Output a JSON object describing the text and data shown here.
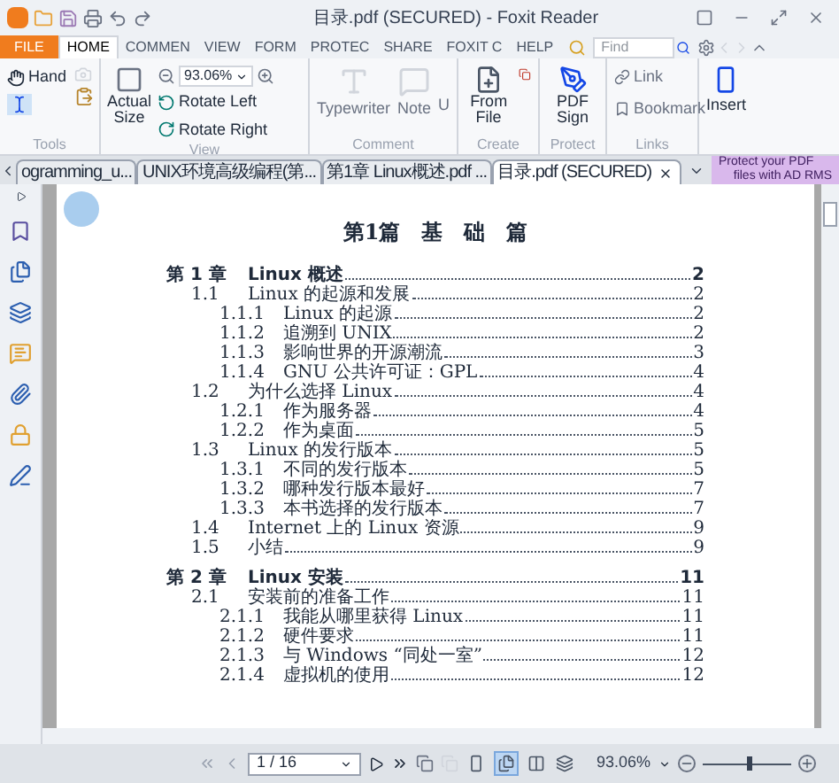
{
  "window": {
    "title": "目录.pdf (SECURED) - Foxit Reader"
  },
  "menu_tabs": [
    {
      "label": "FILE",
      "kind": "file",
      "selected": false
    },
    {
      "label": "HOME",
      "kind": "tab",
      "selected": true
    },
    {
      "label": "COMMEN",
      "kind": "tab",
      "selected": false
    },
    {
      "label": "VIEW",
      "kind": "tab",
      "selected": false
    },
    {
      "label": "FORM",
      "kind": "tab",
      "selected": false
    },
    {
      "label": "PROTEC",
      "kind": "tab",
      "selected": false
    },
    {
      "label": "SHARE",
      "kind": "tab",
      "selected": false
    },
    {
      "label": "FOXIT C",
      "kind": "tab",
      "selected": false
    },
    {
      "label": "HELP",
      "kind": "tab",
      "selected": false
    }
  ],
  "search": {
    "placeholder": "Find"
  },
  "ribbon": {
    "tools": {
      "label": "Tools",
      "hand": "Hand"
    },
    "view": {
      "label": "View",
      "actual_size": "Actual Size",
      "zoom": "93.06%",
      "rotate_left": "Rotate Left",
      "rotate_right": "Rotate Right"
    },
    "comment": {
      "label": "Comment",
      "typewriter": "Typewriter",
      "note": "Note",
      "underline": "U"
    },
    "create": {
      "label": "Create",
      "from_file": "From File"
    },
    "protect": {
      "label": "Protect",
      "pdf_sign": "PDF Sign"
    },
    "links": {
      "label": "Links",
      "link": "Link",
      "bookmark": "Bookmark"
    },
    "insert": {
      "label": "Insert"
    }
  },
  "doc_tabs": [
    {
      "label": "ogramming_u...",
      "selected": false
    },
    {
      "label": "UNIX环境高级编程(第...",
      "selected": false
    },
    {
      "label": "第1章 Linux概述.pdf ...",
      "selected": false
    },
    {
      "label": "目录.pdf (SECURED)",
      "selected": true
    }
  ],
  "ad": {
    "line1": "Protect your PDF",
    "line2": "files with AD RMS"
  },
  "document": {
    "heading": "第1篇　基　础　篇",
    "chapters": [
      {
        "number": "第 1 章",
        "title": "Linux 概述",
        "page": "2",
        "children": [
          {
            "number": "1.1",
            "title": "Linux 的起源和发展",
            "page": "2",
            "children": [
              {
                "number": "1.1.1",
                "title": "Linux 的起源",
                "page": "2"
              },
              {
                "number": "1.1.2",
                "title": "追溯到 UNIX",
                "page": "2"
              },
              {
                "number": "1.1.3",
                "title": "影响世界的开源潮流",
                "page": "3"
              },
              {
                "number": "1.1.4",
                "title": "GNU 公共许可证：GPL",
                "page": "4"
              }
            ]
          },
          {
            "number": "1.2",
            "title": "为什么选择 Linux",
            "page": "4",
            "children": [
              {
                "number": "1.2.1",
                "title": "作为服务器",
                "page": "4"
              },
              {
                "number": "1.2.2",
                "title": "作为桌面",
                "page": "5"
              }
            ]
          },
          {
            "number": "1.3",
            "title": "Linux 的发行版本",
            "page": "5",
            "children": [
              {
                "number": "1.3.1",
                "title": "不同的发行版本",
                "page": "5"
              },
              {
                "number": "1.3.2",
                "title": "哪种发行版本最好",
                "page": "7"
              },
              {
                "number": "1.3.3",
                "title": "本书选择的发行版本",
                "page": "7"
              }
            ]
          },
          {
            "number": "1.4",
            "title": "Internet 上的 Linux 资源",
            "page": "9"
          },
          {
            "number": "1.5",
            "title": "小结",
            "page": "9"
          }
        ]
      },
      {
        "number": "第 2 章",
        "title": "Linux 安装",
        "page": "11",
        "children": [
          {
            "number": "2.1",
            "title": "安装前的准备工作",
            "page": "11",
            "children": [
              {
                "number": "2.1.1",
                "title": "我能从哪里获得 Linux",
                "page": "11"
              },
              {
                "number": "2.1.2",
                "title": "硬件要求",
                "page": "11"
              },
              {
                "number": "2.1.3",
                "title": "与 Windows “同处一室”",
                "page": "12"
              },
              {
                "number": "2.1.4",
                "title": "虚拟机的使用",
                "page": "12"
              }
            ]
          }
        ]
      }
    ]
  },
  "status_bar": {
    "page": "1 / 16",
    "zoom": "93.06%",
    "zoom_slider": {
      "level": 0.55
    },
    "view_modes": [
      {
        "kind": "single",
        "selected": false
      },
      {
        "kind": "continuous",
        "selected": true
      },
      {
        "kind": "facing",
        "selected": false
      },
      {
        "kind": "split",
        "selected": false
      }
    ]
  }
}
